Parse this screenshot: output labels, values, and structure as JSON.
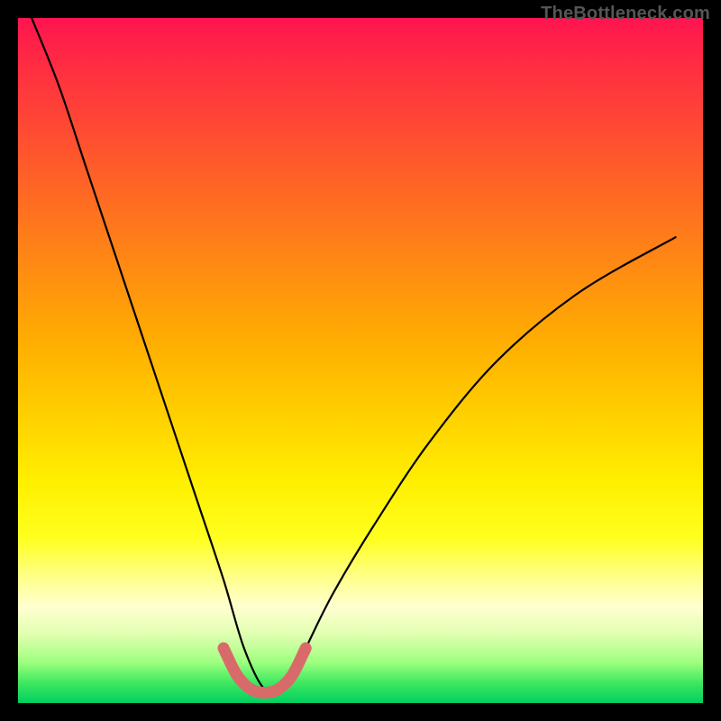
{
  "watermark": "TheBottleneck.com",
  "chart_data": {
    "type": "line",
    "title": "",
    "xlabel": "",
    "ylabel": "",
    "x_range": [
      0,
      100
    ],
    "y_range": [
      0,
      100
    ],
    "note": "V-shaped bottleneck curve over vertical heat gradient (red=high bottleneck, green=balanced). Minimum near x≈36.",
    "series": [
      {
        "name": "bottleneck-curve",
        "x": [
          2,
          6,
          10,
          14,
          18,
          22,
          26,
          30,
          33,
          36,
          39,
          42,
          46,
          52,
          60,
          70,
          82,
          96
        ],
        "y": [
          100,
          90,
          78,
          66,
          54,
          42,
          30,
          18,
          8,
          2,
          2,
          8,
          16,
          26,
          38,
          50,
          60,
          68
        ]
      },
      {
        "name": "optimal-band",
        "x": [
          30,
          32,
          34,
          36,
          38,
          40,
          42
        ],
        "y": [
          8,
          4,
          2,
          1.5,
          2,
          4,
          8
        ]
      }
    ],
    "colors": {
      "curve": "#000000",
      "band": "#d86a6a",
      "gradient_top": "#ff1450",
      "gradient_bottom": "#00d060"
    }
  }
}
